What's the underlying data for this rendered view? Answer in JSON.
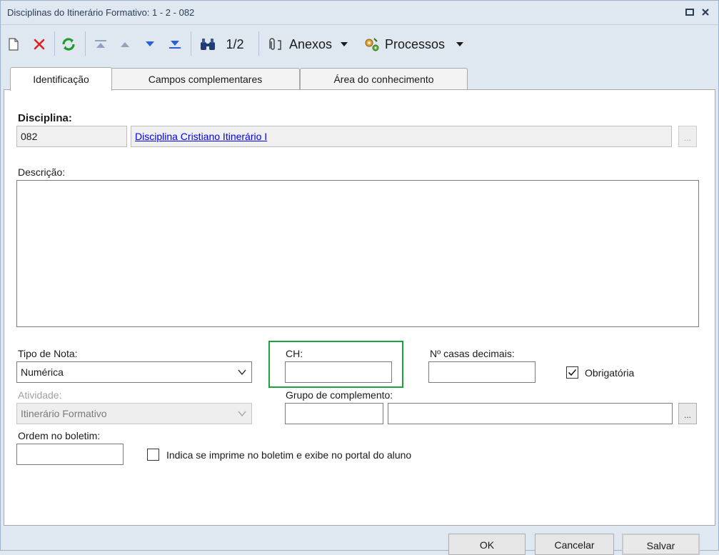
{
  "window": {
    "title": "Disciplinas do Itinerário Formativo: 1 - 2 - 082"
  },
  "toolbar": {
    "record_counter": "1/2",
    "attachments_label": "Anexos",
    "processes_label": "Processos"
  },
  "tabs": [
    {
      "label": "Identificação",
      "active": true
    },
    {
      "label": "Campos complementares",
      "active": false
    },
    {
      "label": "Área do conhecimento",
      "active": false
    }
  ],
  "form": {
    "disciplina": {
      "label": "Disciplina:",
      "code": "082",
      "name": "Disciplina Cristiano Itinerário I",
      "lookup_label": "..."
    },
    "descricao": {
      "label": "Descrição:",
      "value": ""
    },
    "tipo_nota": {
      "label": "Tipo de Nota:",
      "value": "Numérica"
    },
    "ch": {
      "label": "CH:",
      "value": ""
    },
    "casas_decimais": {
      "label": "Nº casas decimais:",
      "value": ""
    },
    "obrigatoria": {
      "label": "Obrigatória",
      "checked": true
    },
    "atividade": {
      "label": "Atividade:",
      "value": "Itinerário Formativo"
    },
    "grupo_complemento": {
      "label": "Grupo de complemento:",
      "code": "",
      "name": "",
      "lookup_label": "..."
    },
    "ordem_boletim": {
      "label": "Ordem no boletim:",
      "value": ""
    },
    "imprime_boletim": {
      "label": "Indica se imprime no boletim e exibe no portal do aluno",
      "checked": false
    }
  },
  "buttons": {
    "ok": "OK",
    "cancel": "Cancelar",
    "save": "Salvar"
  },
  "colors": {
    "highlight": "#1aa33a",
    "link": "#0000ee",
    "delete": "#e02020",
    "refresh": "#1e9a2c",
    "nav_arrow": "#2b5fd9"
  }
}
